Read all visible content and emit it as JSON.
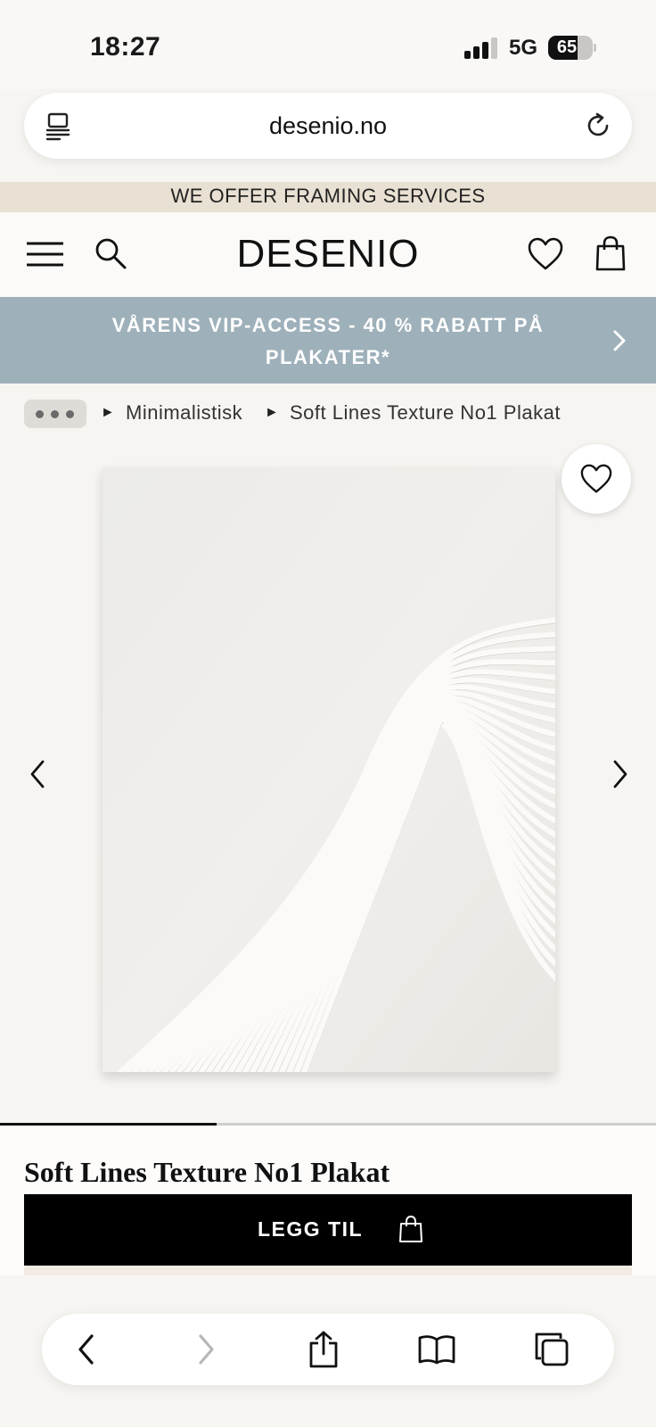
{
  "status_bar": {
    "time": "18:27",
    "network": "5G",
    "battery": "65",
    "battery_level": 0.65,
    "signal_bars": 3
  },
  "browser": {
    "url": "desenio.no",
    "reader_icon": "reader-view-icon",
    "reload_icon": "reload-icon"
  },
  "framing_banner": {
    "text": "WE OFFER FRAMING SERVICES"
  },
  "header": {
    "logo": "DESENIO",
    "menu_icon": "hamburger-menu-icon",
    "search_icon": "search-icon",
    "wishlist_icon": "heart-icon",
    "bag_icon": "shopping-bag-icon"
  },
  "promo": {
    "text": "VÅRENS VIP-ACCESS - 40 % RABATT PÅ PLAKATER*",
    "background": "#9eb0ba"
  },
  "breadcrumb": {
    "separator": "►",
    "items": [
      "Minimalistisk",
      "Soft Lines Texture No1 Plakat"
    ]
  },
  "gallery": {
    "image_alt_icon": "product-artwork",
    "progress": 0.33
  },
  "product": {
    "title": "Soft Lines Texture No1 Plakat",
    "add_label": "LEGG TIL"
  },
  "toolbar": {
    "back_icon": "back-arrow-icon",
    "forward_icon": "forward-arrow-icon",
    "share_icon": "share-icon",
    "bookmarks_icon": "bookmarks-icon",
    "tabs_icon": "tabs-icon"
  },
  "colors": {
    "page_bg": "#f7f5f1",
    "banner_bg": "#e8e0d2",
    "button_bg": "#000000",
    "promo_bg": "#9eb0ba"
  }
}
